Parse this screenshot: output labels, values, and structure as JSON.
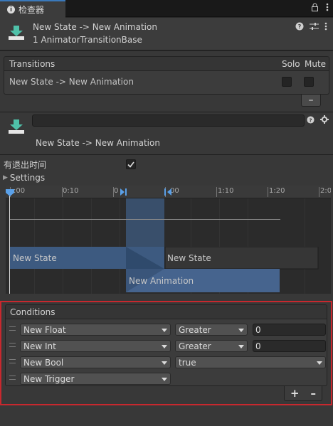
{
  "tab": {
    "title": "检查器"
  },
  "header": {
    "title": "New State -> New Animation",
    "subtitle": "1 AnimatorTransitionBase"
  },
  "transitions": {
    "header": "Transitions",
    "solo_label": "Solo",
    "mute_label": "Mute",
    "rows": [
      {
        "name": "New State -> New Animation",
        "solo": false,
        "mute": false
      }
    ],
    "remove_label": "–"
  },
  "transition": {
    "name_value": "",
    "title": "New State -> New Animation",
    "has_exit_time_label": "有退出时间",
    "has_exit_time": true,
    "settings_label": "Settings"
  },
  "timeline": {
    "ticks": [
      ":00",
      "0:10",
      "0",
      "00",
      "1:10",
      "1:20",
      "2:0"
    ],
    "bars": {
      "a": "New State",
      "b": "New State",
      "c": "New Animation"
    }
  },
  "conditions": {
    "header": "Conditions",
    "rows": [
      {
        "param": "New Float",
        "op": "Greater",
        "value": "0"
      },
      {
        "param": "New Int",
        "op": "Greater",
        "value": "0"
      },
      {
        "param": "New Bool",
        "op": "true",
        "value": ""
      },
      {
        "param": "New Trigger",
        "op": "",
        "value": ""
      }
    ],
    "add_label": "+",
    "remove_label": "–"
  },
  "colors": {
    "accent": "#3a79bb",
    "highlight_border": "#c8282e",
    "state_bar": "#3d5a80",
    "animation_bar": "#46648e"
  }
}
